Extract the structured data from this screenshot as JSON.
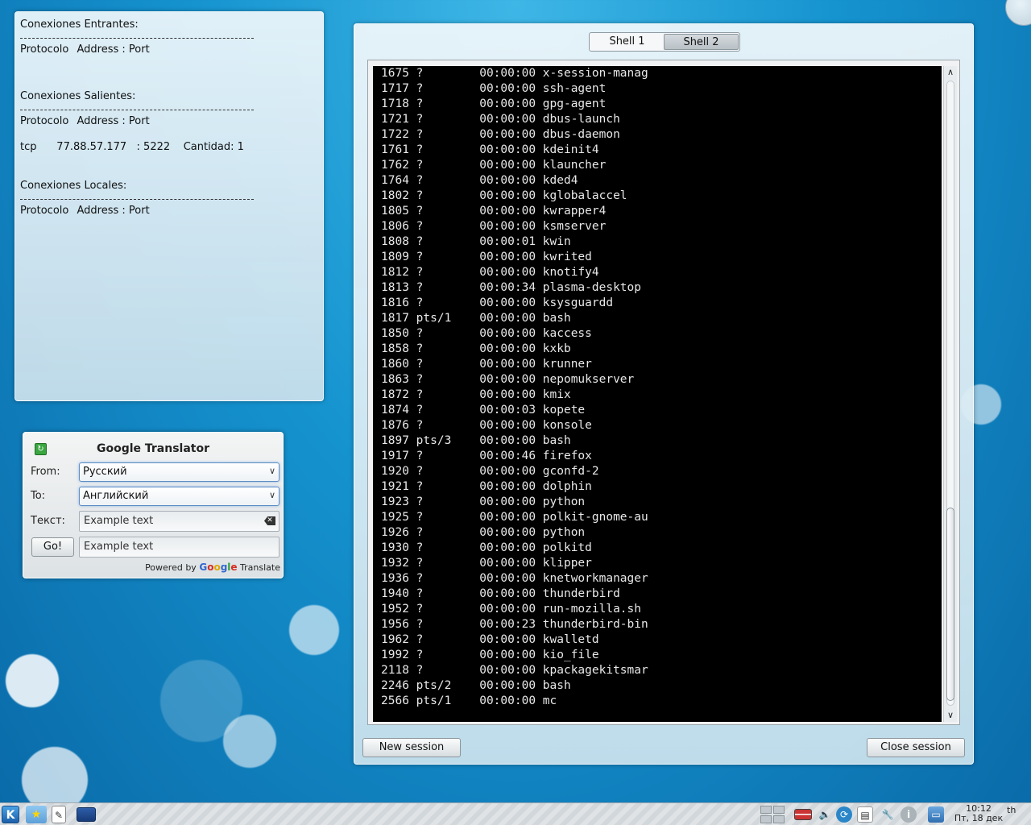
{
  "netstat": {
    "incoming_heading": "Conexiones Entrantes:",
    "outgoing_heading": "Conexiones Salientes:",
    "local_heading": "Conexiones Locales:",
    "col_protocol": "Protocolo",
    "col_address": "Address : Port",
    "outgoing_row": {
      "protocol": "tcp",
      "address": "77.88.57.177",
      "port": ": 5222",
      "count": "Cantidad: 1"
    }
  },
  "translator": {
    "title": "Google Translator",
    "from_label": "From:",
    "to_label": "To:",
    "text_label": "Текст:",
    "from_value": "Русский",
    "to_value": "Английский",
    "input_text": "Example text",
    "output_text": "Example text",
    "go_label": "Go!",
    "powered_by": "Powered by",
    "google_letters": [
      "G",
      "o",
      "o",
      "g",
      "l",
      "e"
    ],
    "translate_label": "Translate"
  },
  "shell": {
    "tabs": [
      "Shell 1",
      "Shell 2"
    ],
    "active_tab": "Shell 2",
    "new_session_label": "New session",
    "close_session_label": "Close session",
    "processes": [
      {
        "pid": "1675",
        "tty": "?",
        "time": "00:00:00",
        "cmd": "x-session-manag"
      },
      {
        "pid": "1717",
        "tty": "?",
        "time": "00:00:00",
        "cmd": "ssh-agent"
      },
      {
        "pid": "1718",
        "tty": "?",
        "time": "00:00:00",
        "cmd": "gpg-agent"
      },
      {
        "pid": "1721",
        "tty": "?",
        "time": "00:00:00",
        "cmd": "dbus-launch"
      },
      {
        "pid": "1722",
        "tty": "?",
        "time": "00:00:00",
        "cmd": "dbus-daemon"
      },
      {
        "pid": "1761",
        "tty": "?",
        "time": "00:00:00",
        "cmd": "kdeinit4"
      },
      {
        "pid": "1762",
        "tty": "?",
        "time": "00:00:00",
        "cmd": "klauncher"
      },
      {
        "pid": "1764",
        "tty": "?",
        "time": "00:00:00",
        "cmd": "kded4"
      },
      {
        "pid": "1802",
        "tty": "?",
        "time": "00:00:00",
        "cmd": "kglobalaccel"
      },
      {
        "pid": "1805",
        "tty": "?",
        "time": "00:00:00",
        "cmd": "kwrapper4"
      },
      {
        "pid": "1806",
        "tty": "?",
        "time": "00:00:00",
        "cmd": "ksmserver"
      },
      {
        "pid": "1808",
        "tty": "?",
        "time": "00:00:01",
        "cmd": "kwin"
      },
      {
        "pid": "1809",
        "tty": "?",
        "time": "00:00:00",
        "cmd": "kwrited"
      },
      {
        "pid": "1812",
        "tty": "?",
        "time": "00:00:00",
        "cmd": "knotify4"
      },
      {
        "pid": "1813",
        "tty": "?",
        "time": "00:00:34",
        "cmd": "plasma-desktop"
      },
      {
        "pid": "1816",
        "tty": "?",
        "time": "00:00:00",
        "cmd": "ksysguardd"
      },
      {
        "pid": "1817",
        "tty": "pts/1",
        "time": "00:00:00",
        "cmd": "bash"
      },
      {
        "pid": "1850",
        "tty": "?",
        "time": "00:00:00",
        "cmd": "kaccess"
      },
      {
        "pid": "1858",
        "tty": "?",
        "time": "00:00:00",
        "cmd": "kxkb"
      },
      {
        "pid": "1860",
        "tty": "?",
        "time": "00:00:00",
        "cmd": "krunner"
      },
      {
        "pid": "1863",
        "tty": "?",
        "time": "00:00:00",
        "cmd": "nepomukserver"
      },
      {
        "pid": "1872",
        "tty": "?",
        "time": "00:00:00",
        "cmd": "kmix"
      },
      {
        "pid": "1874",
        "tty": "?",
        "time": "00:00:03",
        "cmd": "kopete"
      },
      {
        "pid": "1876",
        "tty": "?",
        "time": "00:00:00",
        "cmd": "konsole"
      },
      {
        "pid": "1897",
        "tty": "pts/3",
        "time": "00:00:00",
        "cmd": "bash"
      },
      {
        "pid": "1917",
        "tty": "?",
        "time": "00:00:46",
        "cmd": "firefox"
      },
      {
        "pid": "1920",
        "tty": "?",
        "time": "00:00:00",
        "cmd": "gconfd-2"
      },
      {
        "pid": "1921",
        "tty": "?",
        "time": "00:00:00",
        "cmd": "dolphin"
      },
      {
        "pid": "1923",
        "tty": "?",
        "time": "00:00:00",
        "cmd": "python"
      },
      {
        "pid": "1925",
        "tty": "?",
        "time": "00:00:00",
        "cmd": "polkit-gnome-au"
      },
      {
        "pid": "1926",
        "tty": "?",
        "time": "00:00:00",
        "cmd": "python"
      },
      {
        "pid": "1930",
        "tty": "?",
        "time": "00:00:00",
        "cmd": "polkitd"
      },
      {
        "pid": "1932",
        "tty": "?",
        "time": "00:00:00",
        "cmd": "klipper"
      },
      {
        "pid": "1936",
        "tty": "?",
        "time": "00:00:00",
        "cmd": "knetworkmanager"
      },
      {
        "pid": "1940",
        "tty": "?",
        "time": "00:00:00",
        "cmd": "thunderbird"
      },
      {
        "pid": "1952",
        "tty": "?",
        "time": "00:00:00",
        "cmd": "run-mozilla.sh"
      },
      {
        "pid": "1956",
        "tty": "?",
        "time": "00:00:23",
        "cmd": "thunderbird-bin"
      },
      {
        "pid": "1962",
        "tty": "?",
        "time": "00:00:00",
        "cmd": "kwalletd"
      },
      {
        "pid": "1992",
        "tty": "?",
        "time": "00:00:00",
        "cmd": "kio_file"
      },
      {
        "pid": "2118",
        "tty": "?",
        "time": "00:00:00",
        "cmd": "kpackagekitsmar"
      },
      {
        "pid": "2246",
        "tty": "pts/2",
        "time": "00:00:00",
        "cmd": "bash"
      },
      {
        "pid": "2566",
        "tty": "pts/1",
        "time": "00:00:00",
        "cmd": "mc"
      }
    ]
  },
  "taskbar": {
    "kmenu_glyph": "K",
    "clock_time": "10:12",
    "clock_date": "Пт, 18 дек",
    "user_text": "th"
  },
  "colors": {
    "accent": "#1593cf",
    "terminal_bg": "#000000",
    "terminal_fg": "#e8e8e8"
  }
}
